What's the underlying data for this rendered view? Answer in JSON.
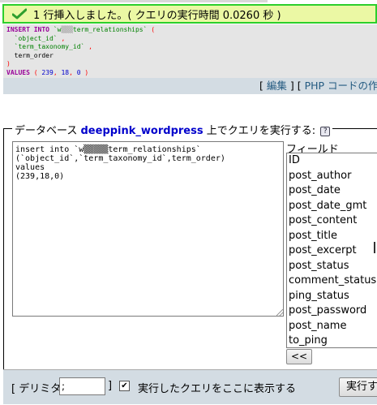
{
  "status": {
    "message": "1 行挿入しました。( クエリの実行時間 0.0260 秒 )"
  },
  "sql_display": {
    "line1_kw": "INSERT INTO",
    "line1_table_prefix": "`w",
    "line1_mask": "▒▒▒",
    "line1_table_suffix": "term_relationships`",
    "line1_paren": "(",
    "line2": "`object_id`",
    "line2_comma": ",",
    "line3": "`term_taxonomy_id`",
    "line3_comma": ",",
    "line4": "term_order",
    "line5": ")",
    "line6_kw": "VALUES",
    "line6_open": "(",
    "line6_v1": "239",
    "line6_v2": "18",
    "line6_v3": "0",
    "line6_close": ")"
  },
  "sql_links": {
    "open": "[",
    "edit": "編集",
    "sep": "] [",
    "php": "PHP コードの作"
  },
  "query_box": {
    "legend_prefix": "データベース",
    "db_name": "deeppink_wordpress",
    "legend_suffix": "上でクエリを実行する:",
    "help": "?",
    "query_text": "insert into `w▒▒▒▒▒term_relationships`\n(`object_id`,`term_taxonomy_id`,term_order)\nvalues\n(239,18,0)"
  },
  "fields": {
    "label": "フィールド",
    "options": [
      "ID",
      "post_author",
      "post_date",
      "post_date_gmt",
      "post_content",
      "post_title",
      "post_excerpt",
      "post_status",
      "comment_status",
      "ping_status",
      "post_password",
      "post_name",
      "to_ping"
    ],
    "insert_button": "<<"
  },
  "bottom": {
    "delimiter_open": "[ デリミタ",
    "delimiter_value": ";",
    "delimiter_close": "]",
    "show_query_label": "実行したクエリをここに表示する",
    "show_query_checked": "✔",
    "execute_button": "実行す"
  }
}
